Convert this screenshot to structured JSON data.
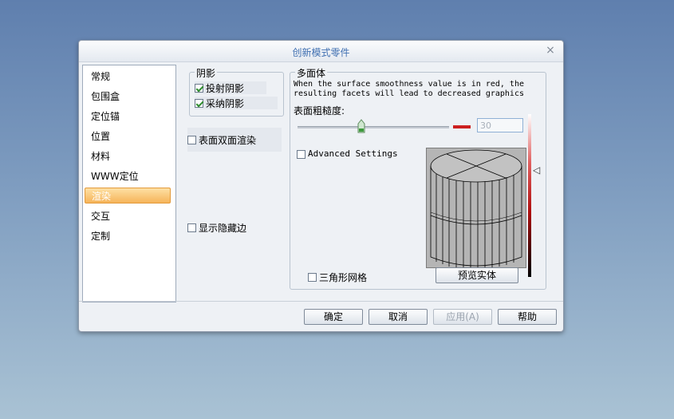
{
  "dialog": {
    "title": "创新模式零件",
    "close_symbol": "×"
  },
  "nav": {
    "items": [
      {
        "label": "常规",
        "selected": false
      },
      {
        "label": "包围盒",
        "selected": false
      },
      {
        "label": "定位锚",
        "selected": false
      },
      {
        "label": "位置",
        "selected": false
      },
      {
        "label": "材料",
        "selected": false
      },
      {
        "label": "WWW定位",
        "selected": false
      },
      {
        "label": "渲染",
        "selected": true
      },
      {
        "label": "交互",
        "selected": false
      },
      {
        "label": "定制",
        "selected": false
      }
    ]
  },
  "shadow": {
    "legend": "阴影",
    "cast_label": "投射阴影",
    "cast_checked": true,
    "receive_label": "采纳阴影",
    "receive_checked": true
  },
  "double_sided": {
    "label": "表面双面渲染",
    "checked": false
  },
  "hidden_edges": {
    "label": "显示隐藏边",
    "checked": false
  },
  "polyhedron": {
    "legend": "多面体",
    "warning": "When the surface smoothness value is in red, the resulting facets will lead to decreased graphics",
    "roughness_label": "表面粗糙度:",
    "roughness_value": "30",
    "slider_level": 0.42,
    "advanced_label": "Advanced Settings",
    "advanced_checked": false,
    "triangle_mesh_label": "三角形网格",
    "triangle_mesh_checked": false,
    "preview_button": "预览实体",
    "marker_symbol": "◁"
  },
  "footer": {
    "ok": "确定",
    "cancel": "取消",
    "apply": "应用(A)",
    "help": "帮助"
  },
  "colors": {
    "accent_red": "#cc1f1f",
    "selected_nav": "#f6b45a",
    "title_blue": "#3f6fb1"
  }
}
